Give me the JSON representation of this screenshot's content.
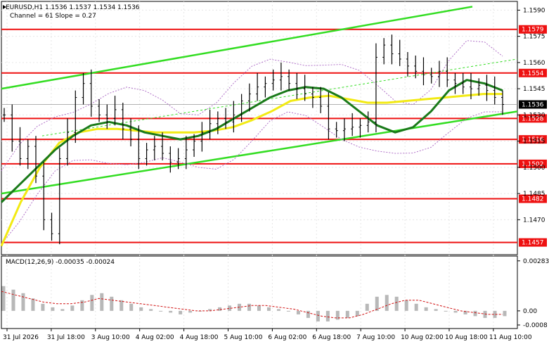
{
  "header": {
    "symbol_line": "EURUSD,H1  1.1536 1.1537 1.1534 1.1536",
    "channel_line": "Channel = 61 Slope = 0.27"
  },
  "macd": {
    "label": "MACD(12,26,9) -0.00035 -0.00024",
    "ticks": [
      "0.00283",
      "0.00",
      "-0.0008"
    ]
  },
  "colors": {
    "price_bar": "#000000",
    "channel": "#33dd22",
    "level": "#ee1111",
    "ma_fast": "#1a7a1a",
    "ma_slow": "#f2ea13",
    "bollinger": "#b070c8",
    "histogram": "#b8b8b8",
    "signal": "#d01010",
    "current_price_tag": "#000000"
  },
  "chart_data": {
    "type": "line",
    "instrument": "EURUSD",
    "timeframe": "H1",
    "ohlc_last": {
      "open": 1.1536,
      "high": 1.1537,
      "low": 1.1534,
      "close": 1.1536
    },
    "ylim": [
      1.145,
      1.1595
    ],
    "y_ticks": [
      1.159,
      1.1575,
      1.156,
      1.1545,
      1.153,
      1.1515,
      1.15,
      1.1485,
      1.147
    ],
    "x_tick_labels": [
      "31 Jul 2026",
      "31 Jul 18:00",
      "3 Aug 10:00",
      "4 Aug 02:00",
      "4 Aug 18:00",
      "5 Aug 10:00",
      "6 Aug 02:00",
      "6 Aug 18:00",
      "7 Aug 10:00",
      "10 Aug 02:00",
      "10 Aug 18:00",
      "11 Aug 10:00"
    ],
    "current_price": 1.1536,
    "horizontal_levels": [
      {
        "label": "1.1579",
        "value": 1.1579
      },
      {
        "label": "1.1554",
        "value": 1.1554
      },
      {
        "label": "1.1528",
        "value": 1.1528
      },
      {
        "label": "1.1516",
        "value": 1.1516
      },
      {
        "label": "1.1502",
        "value": 1.1502
      },
      {
        "label": "1.1482",
        "value": 1.1482
      },
      {
        "label": "1.1457",
        "value": 1.1457
      }
    ],
    "price_close": [
      1.153,
      1.1515,
      1.1505,
      1.1512,
      1.1495,
      1.147,
      1.1462,
      1.1505,
      1.152,
      1.154,
      1.1548,
      1.1535,
      1.153,
      1.1528,
      1.1533,
      1.1522,
      1.1516,
      1.1505,
      1.151,
      1.1512,
      1.1508,
      1.1503,
      1.1505,
      1.151,
      1.1515,
      1.152,
      1.1525,
      1.1528,
      1.1526,
      1.153,
      1.1538,
      1.1542,
      1.1546,
      1.1548,
      1.155,
      1.1552,
      1.1548,
      1.1545,
      1.1542,
      1.154,
      1.1535,
      1.1522,
      1.1521,
      1.1522,
      1.1523,
      1.1524,
      1.1526,
      1.1563,
      1.157,
      1.1565,
      1.1562,
      1.1558,
      1.1555,
      1.1553,
      1.1552,
      1.1555,
      1.155,
      1.1548,
      1.1546,
      1.1545,
      1.1547,
      1.1544,
      1.154,
      1.1536
    ],
    "series": [
      {
        "values": [
          1.148,
          1.149,
          1.15,
          1.151,
          1.1518,
          1.1524,
          1.1526,
          1.1524,
          1.152,
          1.1518,
          1.1516,
          1.1518,
          1.1522,
          1.1528,
          1.1534,
          1.154,
          1.1544,
          1.1546,
          1.1545,
          1.154,
          1.1532,
          1.1524,
          1.152,
          1.1523,
          1.1532,
          1.1544,
          1.155,
          1.1548,
          1.1544
        ]
      },
      {
        "values": [
          1.1455,
          1.148,
          1.15,
          1.1514,
          1.152,
          1.1522,
          1.1522,
          1.1521,
          1.152,
          1.152,
          1.152,
          1.1521,
          1.1523,
          1.1527,
          1.1532,
          1.1538,
          1.154,
          1.1541,
          1.1539,
          1.1537,
          1.1537,
          1.1538,
          1.1539,
          1.154,
          1.1541,
          1.1542,
          1.1542
        ]
      }
    ],
    "channel": {
      "upper": [
        1.1545,
        1.1592
      ],
      "lower": [
        1.1485,
        1.1532
      ]
    },
    "macd_histogram": [
      0.0014,
      0.0012,
      0.001,
      0.0007,
      0.0004,
      0.0002,
      0.0001,
      0.0003,
      0.0006,
      0.0009,
      0.001,
      0.0008,
      0.0006,
      0.0004,
      0.0002,
      0.0001,
      0.0,
      -0.0001,
      -0.0002,
      -0.0001,
      0.0,
      0.0001,
      0.0002,
      0.0003,
      0.0004,
      0.0004,
      0.0003,
      0.0002,
      0.0001,
      0.0,
      -0.0002,
      -0.0004,
      -0.0006,
      -0.0006,
      -0.0005,
      -0.0004,
      -0.0003,
      0.0004,
      0.0008,
      0.0009,
      0.0008,
      0.0006,
      0.0004,
      0.0002,
      0.0001,
      0.0,
      -0.0001,
      -0.0002,
      -0.0003,
      -0.0004,
      -0.0004,
      -0.0003
    ],
    "macd_signal": [
      0.0011,
      0.0009,
      0.0007,
      0.0005,
      0.0004,
      0.0004,
      0.0005,
      0.0007,
      0.0006,
      0.0005,
      0.0004,
      0.0003,
      0.0002,
      0.0001,
      0.0,
      0.0,
      0.0001,
      0.0002,
      0.0003,
      0.0003,
      0.0002,
      0.0001,
      -0.0001,
      -0.0003,
      -0.0004,
      -0.0004,
      -0.0002,
      0.0001,
      0.0004,
      0.0006,
      0.0006,
      0.0004,
      0.0002,
      0.0,
      -0.0001,
      -0.0002,
      -0.0002
    ],
    "macd_ylim": [
      -0.001,
      0.0031
    ]
  }
}
